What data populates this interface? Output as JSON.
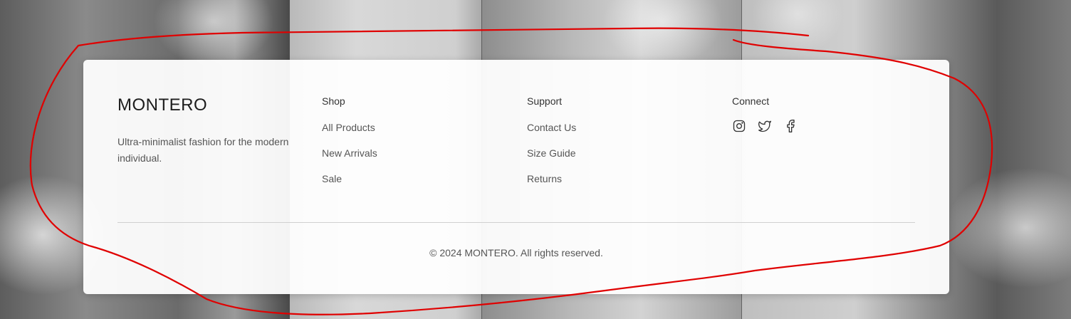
{
  "brand": {
    "name": "MONTERO",
    "tagline": "Ultra-minimalist fashion for the modern individual."
  },
  "shop": {
    "heading": "Shop",
    "links": [
      "All Products",
      "New Arrivals",
      "Sale"
    ]
  },
  "support": {
    "heading": "Support",
    "links": [
      "Contact Us",
      "Size Guide",
      "Returns"
    ]
  },
  "connect": {
    "heading": "Connect",
    "icons": [
      "instagram-icon",
      "twitter-icon",
      "facebook-icon"
    ]
  },
  "footer": {
    "copyright": "© 2024 MONTERO. All rights reserved."
  },
  "colors": {
    "annotation": "#e00000",
    "card": "#ffffff",
    "text": "#555555"
  }
}
